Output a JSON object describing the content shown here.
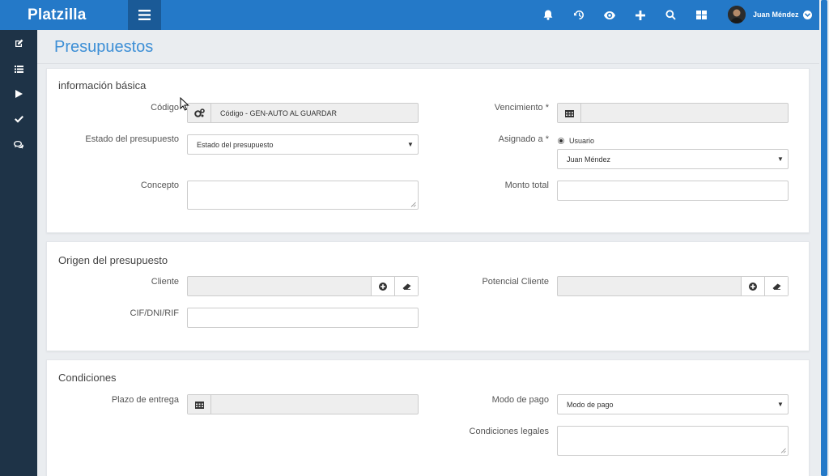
{
  "app": {
    "brand": "Platzilla",
    "accent_color": "#2479c8",
    "sidebar_color": "#1e3347"
  },
  "header": {
    "icons": [
      "menu-icon",
      "bell-icon",
      "history-icon",
      "eye-icon",
      "plus-icon",
      "search-icon",
      "grid-icon"
    ],
    "user_name": "Juan Méndez"
  },
  "sidebar": {
    "items": [
      "edit-icon",
      "list-icon",
      "play-icon",
      "check-icon",
      "comments-icon"
    ]
  },
  "page": {
    "title": "Presupuestos"
  },
  "section_basic": {
    "title": "información básica",
    "codigo_label": "Código",
    "codigo_value": "Código - GEN-AUTO AL GUARDAR",
    "estado_label": "Estado del presupuesto",
    "estado_value": "Estado del presupuesto",
    "concepto_label": "Concepto",
    "concepto_value": "",
    "vencimiento_label": "Vencimiento *",
    "vencimiento_value": "",
    "asignado_label": "Asignado a *",
    "asignado_radio": "Usuario",
    "asignado_value": "Juan Méndez",
    "monto_label": "Monto total",
    "monto_value": ""
  },
  "section_origen": {
    "title": "Origen del presupuesto",
    "cliente_label": "Cliente",
    "cliente_value": "",
    "potencial_label": "Potencial Cliente",
    "potencial_value": "",
    "cif_label": "CIF/DNI/RIF",
    "cif_value": ""
  },
  "section_condiciones": {
    "title": "Condiciones",
    "plazo_label": "Plazo de entrega",
    "plazo_value": "",
    "modo_label": "Modo de pago",
    "modo_value": "Modo de pago",
    "legales_label": "Condiciones legales",
    "legales_value": ""
  }
}
